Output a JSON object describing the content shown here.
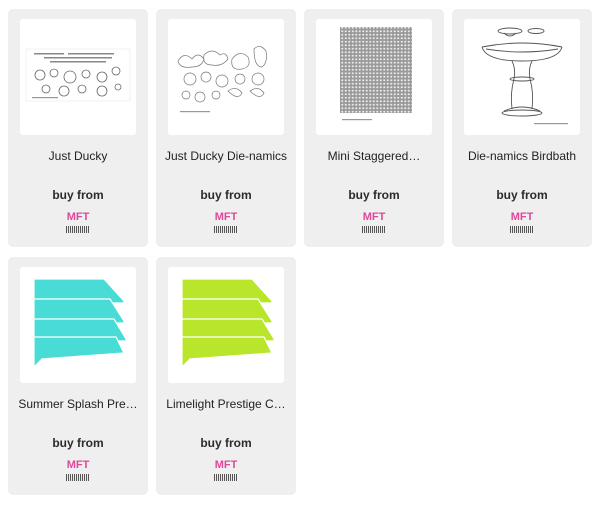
{
  "colors": {
    "card_bg": "#efefef",
    "store_brand": "#e0489b",
    "paper_summer": "#49dcd6",
    "paper_lime": "#b9e62a"
  },
  "products": [
    {
      "title": "Just Ducky",
      "buy_label": "buy from",
      "store": "MFT",
      "image": "stamp-set-sheet"
    },
    {
      "title": "Just Ducky Die-namics",
      "buy_label": "buy from",
      "store": "MFT",
      "image": "die-outline-sheet"
    },
    {
      "title": "Mini Staggered…",
      "buy_label": "buy from",
      "store": "MFT",
      "image": "stencil-grid"
    },
    {
      "title": "Die-namics Birdbath",
      "buy_label": "buy from",
      "store": "MFT",
      "image": "birdbath-die"
    },
    {
      "title": "Summer Splash Pre…",
      "buy_label": "buy from",
      "store": "MFT",
      "image": "cardstock-fan-cyan"
    },
    {
      "title": "Limelight Prestige C…",
      "buy_label": "buy from",
      "store": "MFT",
      "image": "cardstock-fan-lime"
    }
  ]
}
